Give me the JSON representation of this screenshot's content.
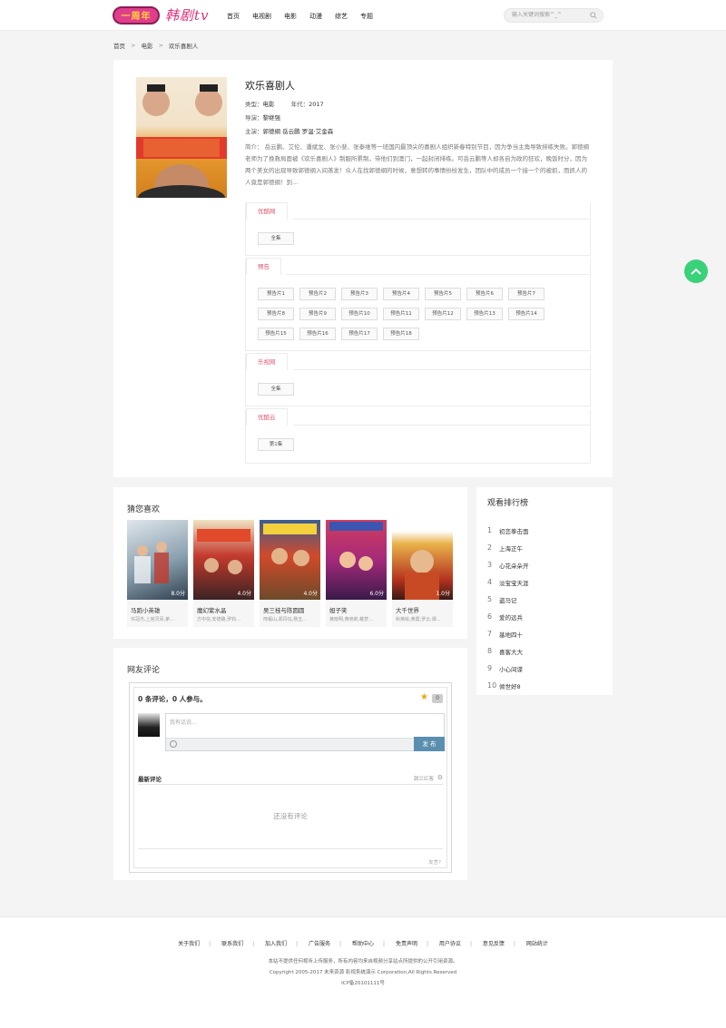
{
  "header": {
    "logo_badge": "一周年",
    "logo_text": "韩剧tv",
    "nav": [
      "首页",
      "电视剧",
      "电影",
      "动漫",
      "综艺",
      "专题"
    ],
    "search_placeholder": "输入关键词搜索^_^"
  },
  "breadcrumb": [
    "首页",
    "电影",
    "欢乐喜剧人"
  ],
  "movie": {
    "title": "欢乐喜剧人",
    "type_label": "类型：",
    "type_value": "电影",
    "year_label": "年代：",
    "year_value": "2017",
    "director_label": "导演：",
    "director_value": "黎继强",
    "cast_label": "主演：",
    "cast_value": "郭德纲  岳云鹏  罗温·艾金森",
    "description": "简介： 岳云鹏、艾伦、潘斌龙、张小斐、张泰维等一班国内最顶尖的喜剧人组织新春特别节目，因为争当主角导致排练失败。郭德纲老师为了挽救局面被《欢乐喜剧人》制服所累制，带他们到澳门，一起封闭排练。可岳云鹏等人却各自为政的狂欢，晚饭时分，因为两个美女的出现导致郭德纲入间蒸发！众人在找郭德纲的时候，意想转的事情纷纷发生，团队中的成员一个接一个的被抓，而抓人的人竟是郭德纲！到..."
  },
  "sources": [
    {
      "name": "优酷网",
      "episodes": [
        "全集"
      ]
    },
    {
      "name": "预告",
      "episodes": [
        "预告片1",
        "预告片2",
        "预告片3",
        "预告片4",
        "预告片5",
        "预告片6",
        "预告片7",
        "预告片8",
        "预告片9",
        "预告片10",
        "预告片11",
        "预告片12",
        "预告片13",
        "预告片14",
        "预告片15",
        "预告片16",
        "预告片17",
        "预告片18"
      ]
    },
    {
      "name": "乐视网",
      "episodes": [
        "全集"
      ]
    },
    {
      "name": "优酷云",
      "episodes": [
        "第1集"
      ]
    }
  ],
  "recommend": {
    "title": "猜您喜欢",
    "items": [
      {
        "name": "马跑小英雄",
        "cast": "许冠杰,上官灵凤,茅...",
        "score": "8.0分"
      },
      {
        "name": "魔幻紫水晶",
        "cast": "方中信,安德路,罗钧...",
        "score": "4.0分"
      },
      {
        "name": "吴三桂与陈圆圆",
        "cast": "邢岷山,郑丹钰,杨玉...",
        "score": "4.0分"
      },
      {
        "name": "妲子笑",
        "cast": "黄晓明,黄晓莉,戴梦...",
        "score": "6.0分"
      },
      {
        "name": "大千世界",
        "cast": "秋英绘,黄霞,罗云,谭...",
        "score": "1.0分"
      }
    ]
  },
  "ranking": {
    "title": "观看排行榜",
    "items": [
      "初恋拳击面",
      "上海正午",
      "心花朵朵开",
      "淡宝宝天涯",
      "盗马记",
      "爱的远兵",
      "基地四十",
      "喜客大大",
      "小心间谍",
      "倾世好8"
    ]
  },
  "comments": {
    "title": "网友评论",
    "count_text": "0 条评论，0 人参与。",
    "star_count": "0",
    "input_placeholder": "我有话说...",
    "submit_label": "发 布",
    "latest_label": "最新评论",
    "sort_label": "跳兰红客",
    "empty_text": "还没有评论",
    "footer_link": "友言?"
  },
  "footer": {
    "links": [
      "关于我们",
      "联系我们",
      "加入我们",
      "广告服务",
      "帮助中心",
      "免责声明",
      "用户协议",
      "意见反馈",
      "网站统计"
    ],
    "disclaimer": "本站不提供任何视听上传服务，所有内容均来自视频分享站点所提供的公开引用资源。",
    "copyright": "Copyright 2005-2017 未来资源 影视系统演示 Corporation,All Rights Reserved",
    "icp": "ICP备20101111号"
  },
  "colors": {
    "accent": "#e0556b",
    "green": "#39d17a",
    "brand": "#e03e8a"
  }
}
